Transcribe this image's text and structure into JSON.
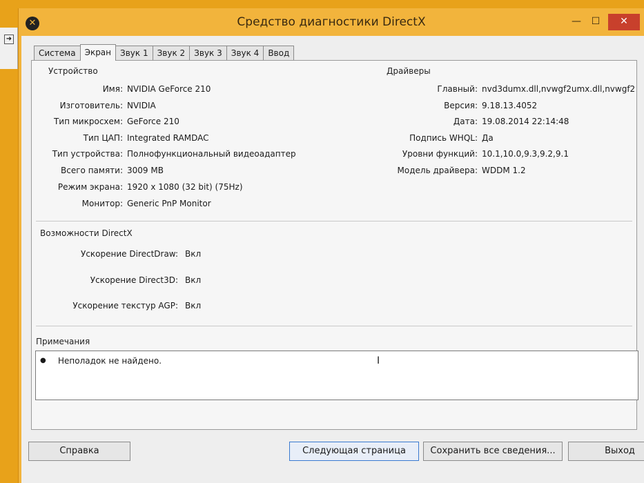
{
  "window": {
    "title": "Средство диагностики DirectX",
    "min_glyph": "—",
    "max_glyph": "☐",
    "close_glyph": "✕"
  },
  "tabs": [
    {
      "label": "Система"
    },
    {
      "label": "Экран"
    },
    {
      "label": "Звук 1"
    },
    {
      "label": "Звук 2"
    },
    {
      "label": "Звук 3"
    },
    {
      "label": "Звук 4"
    },
    {
      "label": "Ввод"
    }
  ],
  "device": {
    "title": "Устройство",
    "rows": [
      {
        "label": "Имя:",
        "value": "NVIDIA GeForce 210"
      },
      {
        "label": "Изготовитель:",
        "value": "NVIDIA"
      },
      {
        "label": "Тип микросхем:",
        "value": "GeForce 210"
      },
      {
        "label": "Тип ЦАП:",
        "value": "Integrated RAMDAC"
      },
      {
        "label": "Тип устройства:",
        "value": "Полнофункциональный видеоадаптер"
      },
      {
        "label": "Всего памяти:",
        "value": "3009 MB"
      },
      {
        "label": "Режим экрана:",
        "value": "1920 x 1080 (32 bit) (75Hz)"
      },
      {
        "label": "Монитор:",
        "value": "Generic PnP Monitor"
      }
    ]
  },
  "drivers": {
    "title": "Драйверы",
    "rows": [
      {
        "label": "Главный:",
        "value": "nvd3dumx.dll,nvwgf2umx.dll,nvwgf2"
      },
      {
        "label": "Версия:",
        "value": "9.18.13.4052"
      },
      {
        "label": "Дата:",
        "value": "19.08.2014 22:14:48"
      },
      {
        "label": "Подпись WHQL:",
        "value": "Да"
      },
      {
        "label": "Уровни функций:",
        "value": "10.1,10.0,9.3,9.2,9.1"
      },
      {
        "label": "Модель драйвера:",
        "value": "WDDM 1.2"
      }
    ]
  },
  "directx": {
    "title": "Возможности DirectX",
    "rows": [
      {
        "label": "Ускорение DirectDraw:",
        "value": "Вкл"
      },
      {
        "label": "Ускорение Direct3D:",
        "value": "Вкл"
      },
      {
        "label": "Ускорение текстур AGP:",
        "value": "Вкл"
      }
    ]
  },
  "notes": {
    "title": "Примечания",
    "items": [
      "Неполадок не найдено."
    ]
  },
  "buttons": {
    "help": "Справка",
    "next": "Следующая страница",
    "save": "Сохранить все сведения...",
    "exit": "Выход"
  }
}
